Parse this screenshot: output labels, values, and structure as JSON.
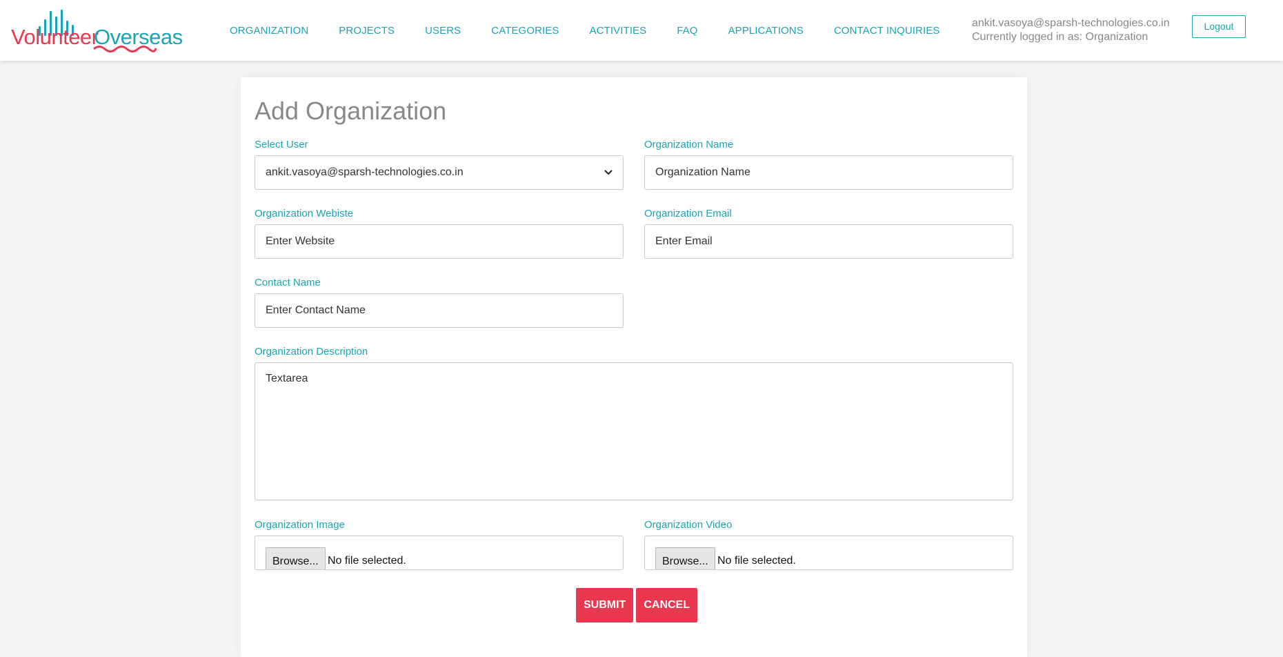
{
  "brand": {
    "name_part1": "Volunteer",
    "name_part2": "Overseas",
    "color_red": "#e8384f",
    "color_teal": "#19a4b4"
  },
  "nav": {
    "items": [
      "ORGANIZATION",
      "PROJECTS",
      "USERS",
      "CATEGORIES",
      "ACTIVITIES",
      "FAQ",
      "APPLICATIONS",
      "CONTACT INQUIRIES"
    ]
  },
  "user": {
    "email": "ankit.vasoya@sparsh-technologies.co.in",
    "role_text": "Currently logged in as: Organization",
    "logout_label": "Logout"
  },
  "form": {
    "title": "Add Organization",
    "select_user": {
      "label": "Select User",
      "value": "ankit.vasoya@sparsh-technologies.co.in"
    },
    "org_name": {
      "label": "Organization Name",
      "placeholder": "Organization Name"
    },
    "website": {
      "label": "Organization Webiste",
      "placeholder": "Enter Website"
    },
    "email": {
      "label": "Organization Email",
      "placeholder": "Enter Email"
    },
    "contact_name": {
      "label": "Contact Name",
      "placeholder": "Enter Contact Name"
    },
    "description": {
      "label": "Organization Description",
      "placeholder": "Textarea"
    },
    "image": {
      "label": "Organization Image",
      "browse_label": "Browse...",
      "status": "No file selected."
    },
    "video": {
      "label": "Organization Video",
      "browse_label": "Browse...",
      "status": "No file selected."
    },
    "submit_label": "SUBMIT",
    "cancel_label": "CANCEL"
  }
}
